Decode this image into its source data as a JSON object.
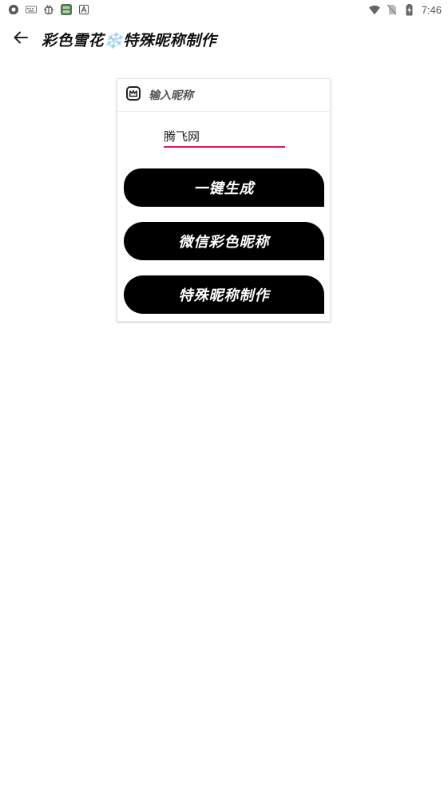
{
  "status_bar": {
    "time": "7:46",
    "left_icons": [
      "chat-bubble-icon",
      "keyboard-icon",
      "bug-icon",
      "app-grid-icon",
      "font-a-icon"
    ],
    "right_icons": [
      "wifi-icon",
      "no-sim-icon",
      "battery-charging-icon"
    ]
  },
  "app_bar": {
    "title": "彩色雪花❄️特殊昵称制作",
    "back_icon": "arrow-back-icon"
  },
  "card": {
    "header_icon": "crown-frame-icon",
    "header_title": "输入昵称",
    "input_value": "腾飞网",
    "buttons": [
      {
        "label": "一键生成"
      },
      {
        "label": "微信彩色昵称"
      },
      {
        "label": "特殊昵称制作"
      }
    ]
  },
  "colors": {
    "accent": "#d81b60",
    "button_bg": "#000000",
    "button_text": "#ffffff"
  }
}
